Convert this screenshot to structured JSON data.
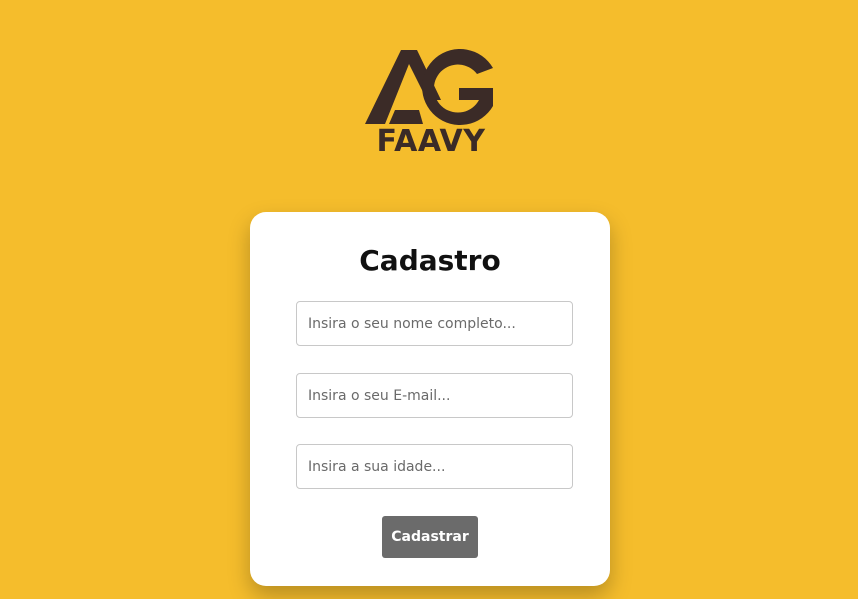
{
  "brand": {
    "logo_icon": "ag-monogram-icon",
    "name": "FAAVY",
    "color": "#3b2b27"
  },
  "form": {
    "title": "Cadastro",
    "fields": {
      "name_placeholder": "Insira o seu nome completo...",
      "email_placeholder": "Insira o seu E-mail...",
      "age_placeholder": "Insira a sua idade..."
    },
    "submit_label": "Cadastrar"
  },
  "colors": {
    "background": "#f5bd2c",
    "card": "#ffffff",
    "button": "#6b6b6b"
  }
}
